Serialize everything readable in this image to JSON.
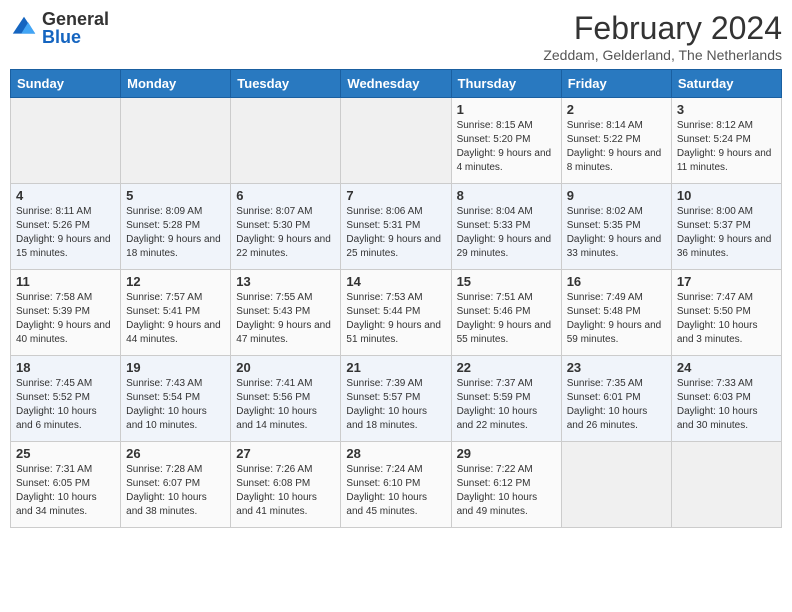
{
  "logo": {
    "general": "General",
    "blue": "Blue"
  },
  "title": "February 2024",
  "location": "Zeddam, Gelderland, The Netherlands",
  "headers": [
    "Sunday",
    "Monday",
    "Tuesday",
    "Wednesday",
    "Thursday",
    "Friday",
    "Saturday"
  ],
  "weeks": [
    [
      {
        "day": "",
        "info": ""
      },
      {
        "day": "",
        "info": ""
      },
      {
        "day": "",
        "info": ""
      },
      {
        "day": "",
        "info": ""
      },
      {
        "day": "1",
        "info": "Sunrise: 8:15 AM\nSunset: 5:20 PM\nDaylight: 9 hours and 4 minutes."
      },
      {
        "day": "2",
        "info": "Sunrise: 8:14 AM\nSunset: 5:22 PM\nDaylight: 9 hours and 8 minutes."
      },
      {
        "day": "3",
        "info": "Sunrise: 8:12 AM\nSunset: 5:24 PM\nDaylight: 9 hours and 11 minutes."
      }
    ],
    [
      {
        "day": "4",
        "info": "Sunrise: 8:11 AM\nSunset: 5:26 PM\nDaylight: 9 hours and 15 minutes."
      },
      {
        "day": "5",
        "info": "Sunrise: 8:09 AM\nSunset: 5:28 PM\nDaylight: 9 hours and 18 minutes."
      },
      {
        "day": "6",
        "info": "Sunrise: 8:07 AM\nSunset: 5:30 PM\nDaylight: 9 hours and 22 minutes."
      },
      {
        "day": "7",
        "info": "Sunrise: 8:06 AM\nSunset: 5:31 PM\nDaylight: 9 hours and 25 minutes."
      },
      {
        "day": "8",
        "info": "Sunrise: 8:04 AM\nSunset: 5:33 PM\nDaylight: 9 hours and 29 minutes."
      },
      {
        "day": "9",
        "info": "Sunrise: 8:02 AM\nSunset: 5:35 PM\nDaylight: 9 hours and 33 minutes."
      },
      {
        "day": "10",
        "info": "Sunrise: 8:00 AM\nSunset: 5:37 PM\nDaylight: 9 hours and 36 minutes."
      }
    ],
    [
      {
        "day": "11",
        "info": "Sunrise: 7:58 AM\nSunset: 5:39 PM\nDaylight: 9 hours and 40 minutes."
      },
      {
        "day": "12",
        "info": "Sunrise: 7:57 AM\nSunset: 5:41 PM\nDaylight: 9 hours and 44 minutes."
      },
      {
        "day": "13",
        "info": "Sunrise: 7:55 AM\nSunset: 5:43 PM\nDaylight: 9 hours and 47 minutes."
      },
      {
        "day": "14",
        "info": "Sunrise: 7:53 AM\nSunset: 5:44 PM\nDaylight: 9 hours and 51 minutes."
      },
      {
        "day": "15",
        "info": "Sunrise: 7:51 AM\nSunset: 5:46 PM\nDaylight: 9 hours and 55 minutes."
      },
      {
        "day": "16",
        "info": "Sunrise: 7:49 AM\nSunset: 5:48 PM\nDaylight: 9 hours and 59 minutes."
      },
      {
        "day": "17",
        "info": "Sunrise: 7:47 AM\nSunset: 5:50 PM\nDaylight: 10 hours and 3 minutes."
      }
    ],
    [
      {
        "day": "18",
        "info": "Sunrise: 7:45 AM\nSunset: 5:52 PM\nDaylight: 10 hours and 6 minutes."
      },
      {
        "day": "19",
        "info": "Sunrise: 7:43 AM\nSunset: 5:54 PM\nDaylight: 10 hours and 10 minutes."
      },
      {
        "day": "20",
        "info": "Sunrise: 7:41 AM\nSunset: 5:56 PM\nDaylight: 10 hours and 14 minutes."
      },
      {
        "day": "21",
        "info": "Sunrise: 7:39 AM\nSunset: 5:57 PM\nDaylight: 10 hours and 18 minutes."
      },
      {
        "day": "22",
        "info": "Sunrise: 7:37 AM\nSunset: 5:59 PM\nDaylight: 10 hours and 22 minutes."
      },
      {
        "day": "23",
        "info": "Sunrise: 7:35 AM\nSunset: 6:01 PM\nDaylight: 10 hours and 26 minutes."
      },
      {
        "day": "24",
        "info": "Sunrise: 7:33 AM\nSunset: 6:03 PM\nDaylight: 10 hours and 30 minutes."
      }
    ],
    [
      {
        "day": "25",
        "info": "Sunrise: 7:31 AM\nSunset: 6:05 PM\nDaylight: 10 hours and 34 minutes."
      },
      {
        "day": "26",
        "info": "Sunrise: 7:28 AM\nSunset: 6:07 PM\nDaylight: 10 hours and 38 minutes."
      },
      {
        "day": "27",
        "info": "Sunrise: 7:26 AM\nSunset: 6:08 PM\nDaylight: 10 hours and 41 minutes."
      },
      {
        "day": "28",
        "info": "Sunrise: 7:24 AM\nSunset: 6:10 PM\nDaylight: 10 hours and 45 minutes."
      },
      {
        "day": "29",
        "info": "Sunrise: 7:22 AM\nSunset: 6:12 PM\nDaylight: 10 hours and 49 minutes."
      },
      {
        "day": "",
        "info": ""
      },
      {
        "day": "",
        "info": ""
      }
    ]
  ]
}
